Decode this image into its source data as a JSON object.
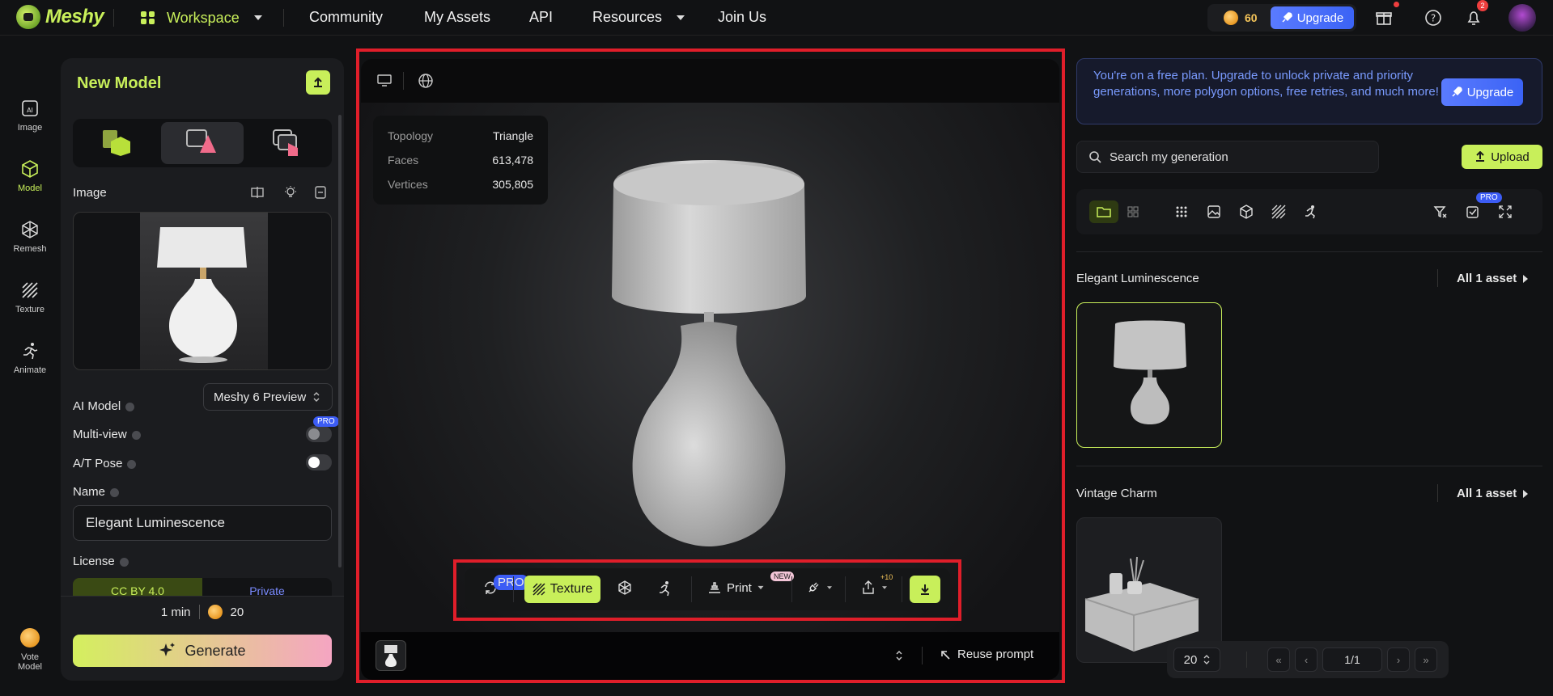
{
  "app": {
    "logo": "Meshy"
  },
  "nav": {
    "workspace": "Workspace",
    "community": "Community",
    "my_assets": "My Assets",
    "api": "API",
    "resources": "Resources",
    "join_us": "Join Us"
  },
  "header": {
    "credits": "60",
    "upgrade": "Upgrade",
    "notif_count": "2"
  },
  "rail": [
    {
      "label": "Image",
      "icon": "image-ai-icon"
    },
    {
      "label": "Model",
      "icon": "cube-icon"
    },
    {
      "label": "Remesh",
      "icon": "remesh-icon"
    },
    {
      "label": "Texture",
      "icon": "texture-icon"
    },
    {
      "label": "Animate",
      "icon": "running-figure-icon"
    },
    {
      "label": "Vote Model",
      "icon": "vote-icon"
    }
  ],
  "left": {
    "title": "New Model",
    "image_label": "Image",
    "ai_model_label": "AI Model",
    "ai_model_value": "Meshy 6 Preview",
    "multiview_label": "Multi-view",
    "pro": "PRO",
    "atpose_label": "A/T Pose",
    "name_label": "Name",
    "name_value": "Elegant Luminescence",
    "license_label": "License",
    "license_options": [
      "CC BY 4.0",
      "Private"
    ],
    "time": "1 min",
    "cost": "20",
    "generate": "Generate"
  },
  "viewer": {
    "stats": [
      {
        "k": "Topology",
        "v": "Triangle"
      },
      {
        "k": "Faces",
        "v": "613,478"
      },
      {
        "k": "Vertices",
        "v": "305,805"
      }
    ],
    "toolbar": {
      "pro": "PRO",
      "texture": "Texture",
      "print": "Print",
      "new": "NEW",
      "plus10": "+10"
    },
    "reuse_prompt": "Reuse prompt"
  },
  "right": {
    "promo": "You're on a free plan. Upgrade to unlock private and priority generations, more polygon options, free retries, and much more!",
    "upgrade": "Upgrade",
    "search_placeholder": "Search my generation",
    "upload": "Upload",
    "pro": "PRO",
    "groups": [
      {
        "title": "Elegant Luminescence",
        "all": "All 1 asset"
      },
      {
        "title": "Vintage Charm",
        "all": "All 1 asset"
      }
    ],
    "pager": {
      "per_page": "20",
      "page": "1/1"
    }
  },
  "colors": {
    "accent": "#c8ef5a",
    "blue": "#3b63f5",
    "highlight": "#e01e2a"
  }
}
